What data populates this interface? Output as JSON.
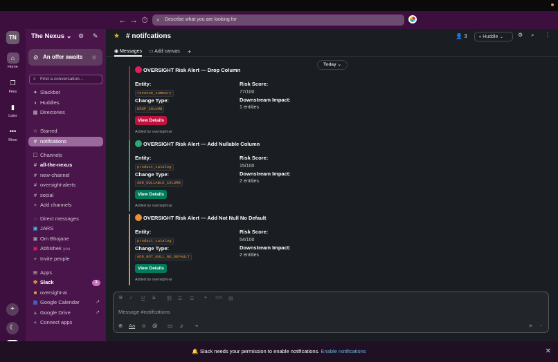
{
  "topbar": {
    "back": "←",
    "forward": "→",
    "history": "⏱",
    "search_placeholder": "Describe what you are looking for",
    "search_icon": "⌕"
  },
  "rail": {
    "workspace_initials": "TN",
    "items": [
      {
        "label": "Home",
        "icon": "home-icon",
        "glyph": "⌂"
      },
      {
        "label": "Files",
        "icon": "files-icon",
        "glyph": "❐"
      },
      {
        "label": "Later",
        "icon": "bookmark-icon",
        "glyph": "▮"
      },
      {
        "label": "More",
        "icon": "more-icon",
        "glyph": "•••"
      }
    ],
    "add": "+",
    "theme": "☾"
  },
  "sidebar": {
    "workspace_name": "The Nexus ⌄",
    "offer": "An offer awaits",
    "find_placeholder": "Find a conversation...",
    "top_items": [
      {
        "label": "Slackbot",
        "glyph": "✦"
      },
      {
        "label": "Huddles",
        "glyph": "◖"
      },
      {
        "label": "Directories",
        "glyph": "▦"
      }
    ],
    "starred_header": "Starred",
    "starred": [
      {
        "label": "notifcations",
        "glyph": "#"
      }
    ],
    "channels_header": "Channels",
    "channels": [
      {
        "label": "all-the-nexus",
        "glyph": "#",
        "bold": true
      },
      {
        "label": "new-channel",
        "glyph": "#"
      },
      {
        "label": "oversight-alerts",
        "glyph": "#"
      },
      {
        "label": "social",
        "glyph": "#"
      },
      {
        "label": "Add channels",
        "glyph": "+"
      }
    ],
    "dm_header": "Direct messages",
    "dms": [
      {
        "label": "JARS"
      },
      {
        "label": "Om Bhojane"
      },
      {
        "label": "Abhishek",
        "suffix": "you"
      },
      {
        "label": "Invite people",
        "glyph": "+"
      }
    ],
    "apps_header": "Apps",
    "apps": [
      {
        "label": "Slack",
        "badge": "1",
        "bold": true
      },
      {
        "label": "oversight-ai"
      },
      {
        "label": "Google Calendar",
        "ext": "↗"
      },
      {
        "label": "Google Drive",
        "ext": "↗"
      },
      {
        "label": "Connect apps",
        "glyph": "+"
      }
    ]
  },
  "channel": {
    "title": "# notifcations",
    "members": "3",
    "huddle": "Huddle",
    "tabs": [
      {
        "label": "Messages"
      },
      {
        "label": "Add canvas"
      }
    ],
    "today": "Today ⌄"
  },
  "alerts": [
    {
      "title": "OVERSIGHT Risk Alert — Drop Column",
      "severity_color": "#e01e5a",
      "entity_label": "Entity:",
      "entity": "revenue_summary",
      "change_label": "Change Type:",
      "change": "DROP_COLUMN",
      "risk_label": "Risk Score:",
      "risk": "77/100",
      "impact_label": "Downstream Impact:",
      "impact": "1 entities",
      "button": "View Details",
      "button_color": "#c1113f",
      "bar_color": "#c7174f",
      "added": "Added by oversight-ai"
    },
    {
      "title": "OVERSIGHT Risk Alert — Add Nullable Column",
      "severity_color": "#2bac76",
      "entity_label": "Entity:",
      "entity": "product_catalog",
      "change_label": "Change Type:",
      "change": "ADD_NULLABLE_COLUMN",
      "risk_label": "Risk Score:",
      "risk": "15/100",
      "impact_label": "Downstream Impact:",
      "impact": "2 entities",
      "button": "View Details",
      "button_color": "#007a5a",
      "bar_color": "#2bac76",
      "added": "Added by oversight-ai"
    },
    {
      "title": "OVERSIGHT Risk Alert — Add Not Null No Default",
      "severity_color": "#e8912d",
      "entity_label": "Entity:",
      "entity": "product_catalog",
      "change_label": "Change Type:",
      "change": "ADD_NOT_NULL_NO_DEFAULT",
      "risk_label": "Risk Score:",
      "risk": "54/100",
      "impact_label": "Downstream Impact:",
      "impact": "2 entities",
      "button": "View Details",
      "button_color": "#007a5a",
      "bar_color": "#e8912d",
      "added": "Added by oversight-ai"
    }
  ],
  "composer": {
    "placeholder": "Message #notifcations"
  },
  "banner": {
    "text": "Slack needs your permission to enable notifications.",
    "link": "Enable notifications",
    "bell": "🔔",
    "close": "✕"
  }
}
